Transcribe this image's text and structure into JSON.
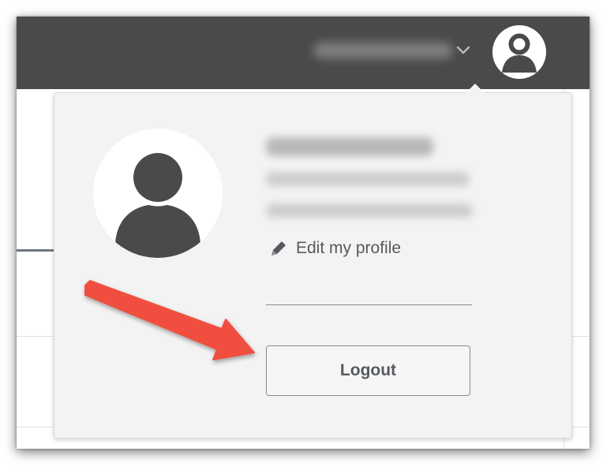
{
  "header": {
    "user_menu_toggle_icon": "chevron-down-icon",
    "avatar_icon": "user-avatar-icon",
    "background_color": "#4a4a4a"
  },
  "profile_menu": {
    "avatar_icon": "user-avatar-icon",
    "edit_profile_icon": "pencil-icon",
    "edit_profile_label": "Edit my profile",
    "logout_label": "Logout"
  },
  "annotation": {
    "arrow_color": "#f0503f"
  }
}
